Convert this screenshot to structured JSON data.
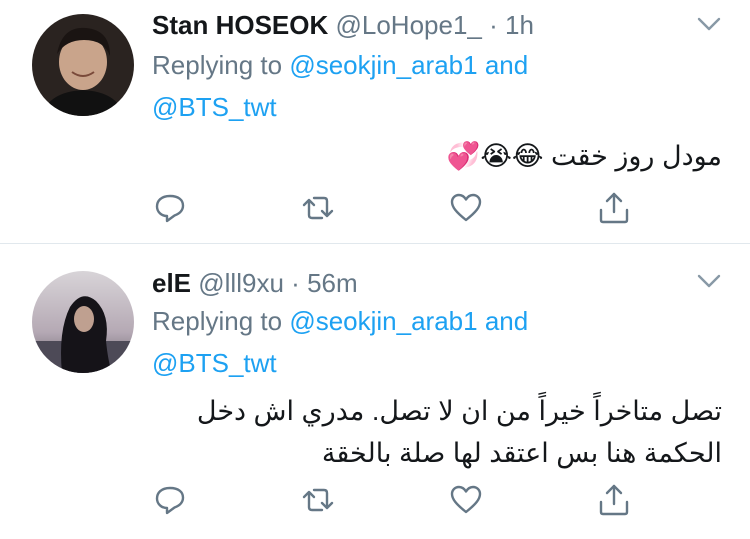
{
  "tweets": [
    {
      "name": "Stan HOSEOK",
      "handle": "@LoHope1_",
      "dot": "·",
      "time": "1h",
      "replying_prefix": "Replying to ",
      "mention1": "@seokjin_arab1",
      "and": "and",
      "mention2": "@BTS_twt",
      "text": "مودل روز خقت 😂😭💞"
    },
    {
      "name": "elE",
      "handle": "@lll9xu",
      "dot": "·",
      "time": "56m",
      "replying_prefix": "Replying to ",
      "mention1": "@seokjin_arab1",
      "and": "and",
      "mention2": "@BTS_twt",
      "text": "تصل متاخراً خيراً من ان لا تصل. مدري اش دخل الحكمة هنا بس اعتقد لها صلة بالخقة"
    }
  ],
  "icons": {
    "reply": "reply-icon",
    "retweet": "retweet-icon",
    "like": "heart-icon",
    "share": "share-icon",
    "more": "chevron-down-icon"
  },
  "colors": {
    "link": "#1da1f2",
    "muted": "#657786",
    "text": "#14171a",
    "divider": "#e1e8ed"
  }
}
